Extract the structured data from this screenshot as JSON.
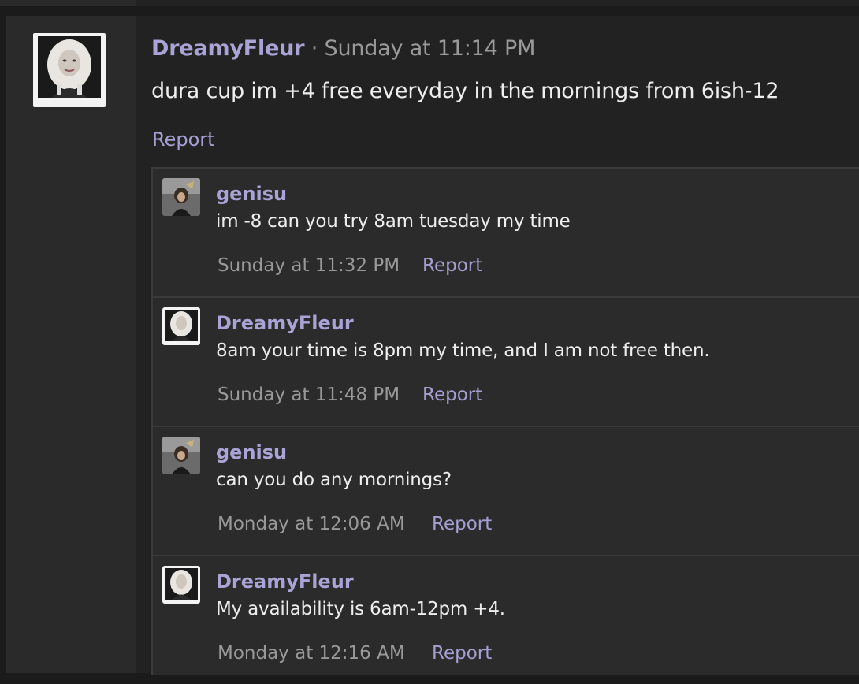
{
  "post": {
    "author": "DreamyFleur",
    "separator": " · ",
    "timestamp": "Sunday at 11:14 PM",
    "body": "dura cup im +4 free everyday in the mornings from 6ish-12",
    "report_label": "Report",
    "avatar_icon": "user-avatar-icon"
  },
  "replies": [
    {
      "author": "genisu",
      "text": "im -8 can you try 8am tuesday my time",
      "timestamp": "Sunday at 11:32 PM",
      "report_label": "Report"
    },
    {
      "author": "DreamyFleur",
      "text": "8am your time is 8pm my time, and I am not free then.",
      "timestamp": "Sunday at 11:48 PM",
      "report_label": "Report"
    },
    {
      "author": "genisu",
      "text": "can you do any mornings?",
      "timestamp": "Monday at 12:06 AM",
      "report_label": "Report"
    },
    {
      "author": "DreamyFleur",
      "text": "My availability is 6am-12pm +4.",
      "timestamp": "Monday at 12:16 AM",
      "report_label": "Report"
    }
  ],
  "colors": {
    "author": "#a9a3d6",
    "link": "#a6a0d2",
    "timestamp": "#999999",
    "background": "#222222"
  }
}
